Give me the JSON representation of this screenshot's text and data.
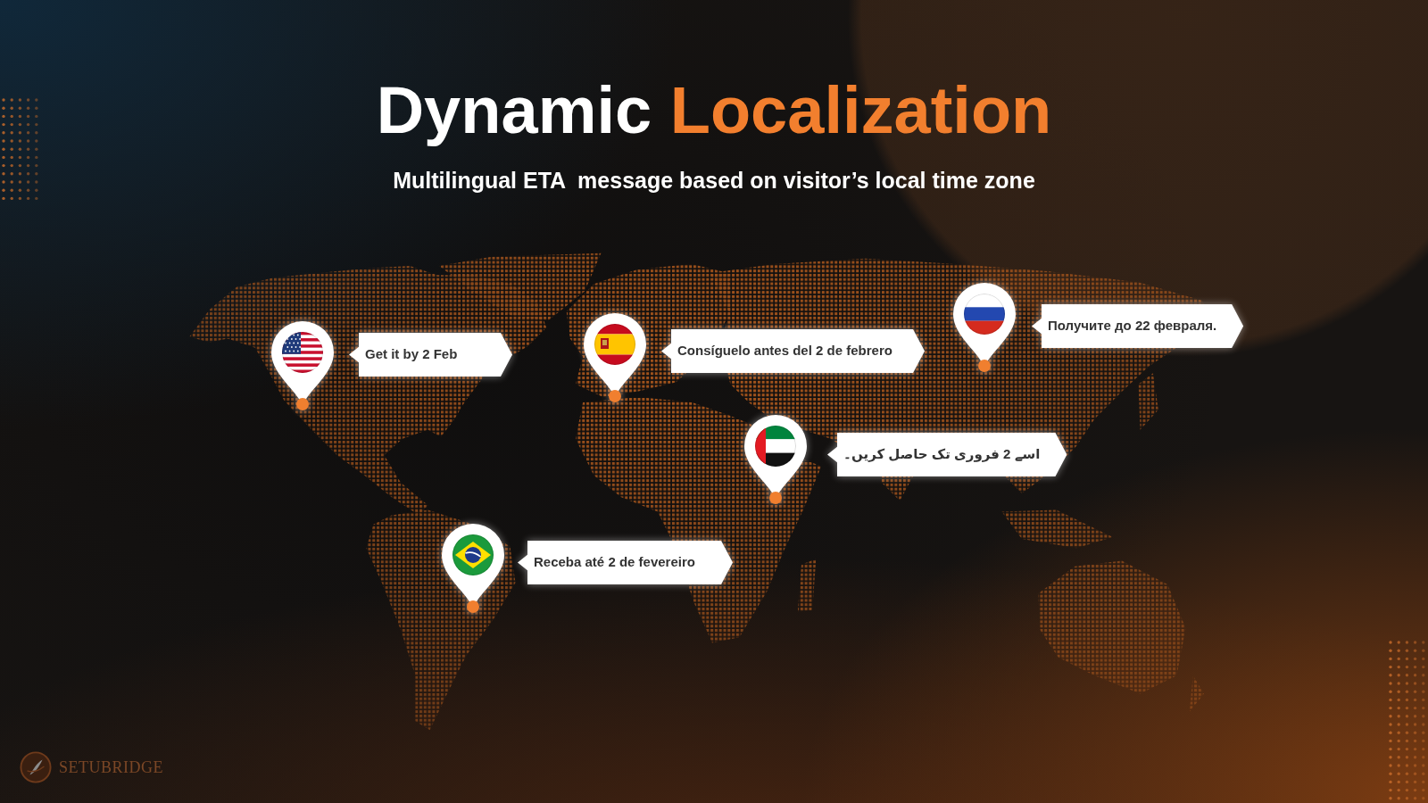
{
  "title": {
    "plain": "Dynamic",
    "highlight": "Localization"
  },
  "subtitle": "Multilingual ETA  message based on visitor’s local time zone",
  "map": {
    "markers": [
      {
        "kind": "us",
        "message": "Get it by 2 Feb"
      },
      {
        "kind": "es",
        "message": "Consíguelo antes del 2 de febrero"
      },
      {
        "kind": "ru",
        "message": "Получите до 22 февраля."
      },
      {
        "kind": "ae",
        "message": "اسے 2 فروری تک حاصل کریں۔"
      },
      {
        "kind": "br",
        "message": "Receba até 2 de fevereiro"
      }
    ]
  },
  "logo": {
    "text": "SETUBRIDGE"
  }
}
